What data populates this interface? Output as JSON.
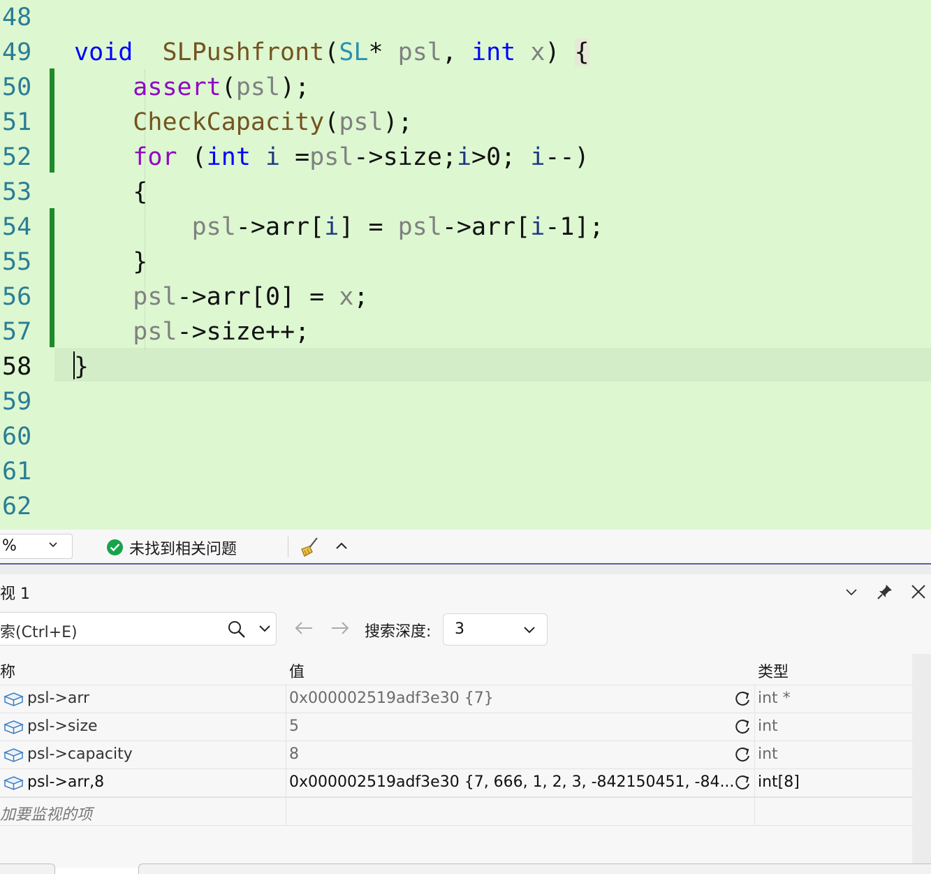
{
  "editor": {
    "lines": [
      {
        "no": "48",
        "segs": []
      },
      {
        "no": "49",
        "segs": [
          [
            "kw",
            "void"
          ],
          [
            "pn",
            "  "
          ],
          [
            "fn",
            "SLPushfront"
          ],
          [
            "pn",
            "("
          ],
          [
            "ty",
            "SL"
          ],
          [
            "pn",
            "* "
          ],
          [
            "pa",
            "psl"
          ],
          [
            "pn",
            ", "
          ],
          [
            "kw",
            "int"
          ],
          [
            "pn",
            " "
          ],
          [
            "pa",
            "x"
          ],
          [
            "pn",
            ") "
          ],
          [
            "hl",
            "{"
          ]
        ]
      },
      {
        "no": "50",
        "segs": [
          [
            "pn",
            "    "
          ],
          [
            "kwc",
            "assert"
          ],
          [
            "pn",
            "("
          ],
          [
            "pa",
            "psl"
          ],
          [
            "pn",
            ");"
          ]
        ]
      },
      {
        "no": "51",
        "segs": [
          [
            "pn",
            "    "
          ],
          [
            "fn",
            "CheckCapacity"
          ],
          [
            "pn",
            "("
          ],
          [
            "pa",
            "psl"
          ],
          [
            "pn",
            ");"
          ]
        ]
      },
      {
        "no": "52",
        "segs": [
          [
            "pn",
            "    "
          ],
          [
            "kwc",
            "for"
          ],
          [
            "pn",
            " ("
          ],
          [
            "kw",
            "int"
          ],
          [
            "pn",
            " "
          ],
          [
            "id",
            "i"
          ],
          [
            "pn",
            " ="
          ],
          [
            "pa",
            "psl"
          ],
          [
            "pn",
            "->size;"
          ],
          [
            "id",
            "i"
          ],
          [
            "pn",
            ">0; "
          ],
          [
            "id",
            "i"
          ],
          [
            "pn",
            "--)"
          ]
        ]
      },
      {
        "no": "53",
        "segs": [
          [
            "pn",
            "    {"
          ]
        ]
      },
      {
        "no": "54",
        "segs": [
          [
            "pn",
            "        "
          ],
          [
            "pa",
            "psl"
          ],
          [
            "pn",
            "->arr["
          ],
          [
            "id",
            "i"
          ],
          [
            "pn",
            "] = "
          ],
          [
            "pa",
            "psl"
          ],
          [
            "pn",
            "->arr["
          ],
          [
            "id",
            "i"
          ],
          [
            "pn",
            "-1];"
          ]
        ]
      },
      {
        "no": "55",
        "segs": [
          [
            "pn",
            "    }"
          ]
        ]
      },
      {
        "no": "56",
        "segs": [
          [
            "pn",
            "    "
          ],
          [
            "pa",
            "psl"
          ],
          [
            "pn",
            "->arr[0] = "
          ],
          [
            "pa",
            "x"
          ],
          [
            "pn",
            ";"
          ]
        ]
      },
      {
        "no": "57",
        "segs": [
          [
            "pn",
            "    "
          ],
          [
            "pa",
            "psl"
          ],
          [
            "pn",
            "->size++;"
          ]
        ]
      },
      {
        "no": "58",
        "segs": [
          [
            "pn",
            "}"
          ]
        ]
      },
      {
        "no": "59",
        "segs": []
      },
      {
        "no": "60",
        "segs": []
      },
      {
        "no": "61",
        "segs": []
      },
      {
        "no": "62",
        "segs": []
      }
    ],
    "current_line": "58"
  },
  "statusbar": {
    "zoom_value": "%",
    "issues_text": "未找到相关问题"
  },
  "watch": {
    "title": "视 1",
    "search_placeholder": "索(Ctrl+E)",
    "depth_label": "搜索深度:",
    "depth_value": "3",
    "columns": {
      "name": "称",
      "value": "值",
      "type": "类型"
    },
    "rows": [
      {
        "name": "psl->arr",
        "value": "0x000002519adf3e30 {7}",
        "type": "int *",
        "active": false
      },
      {
        "name": "psl->size",
        "value": "5",
        "type": "int",
        "active": false
      },
      {
        "name": "psl->capacity",
        "value": "8",
        "type": "int",
        "active": false
      },
      {
        "name": "psl->arr,8",
        "value": "0x000002519adf3e30 {7, 666, 1, 2, 3, -842150451, -84...",
        "type": "int[8]",
        "active": true
      }
    ],
    "add_item_text": "加要监视的项"
  }
}
